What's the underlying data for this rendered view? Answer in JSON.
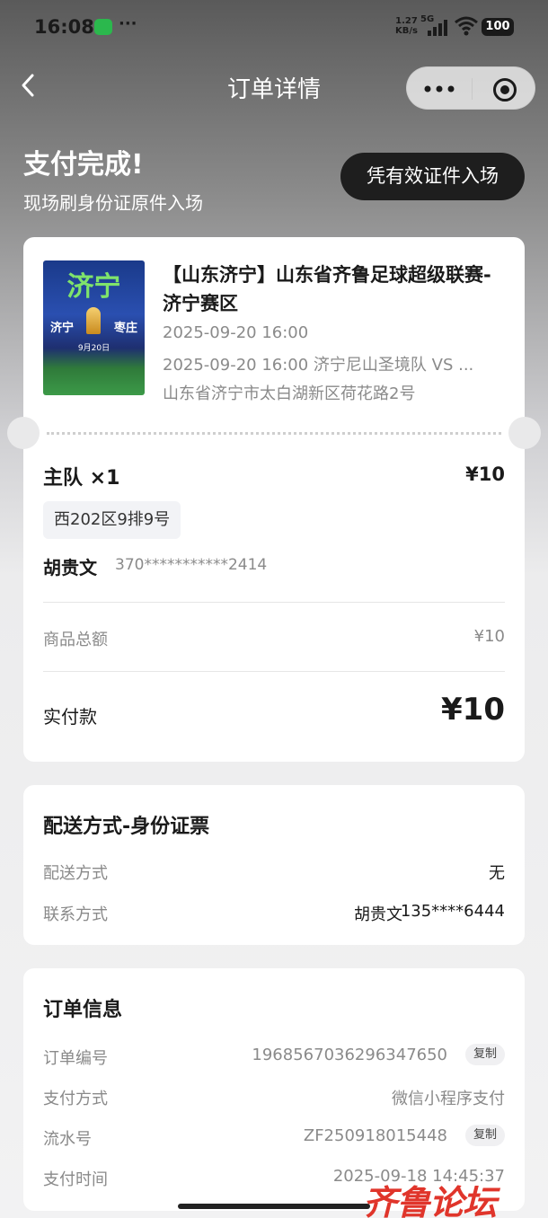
{
  "status_bar": {
    "time": "16:08",
    "speed": "1.27",
    "speed_unit": "KB/s",
    "network": "5G",
    "battery": "100"
  },
  "nav": {
    "title": "订单详情"
  },
  "hero": {
    "title": "支付完成!",
    "subtitle": "现场刷身份证原件入场",
    "button": "凭有效证件入场"
  },
  "event": {
    "poster_title": "济宁",
    "poster_home": "济宁",
    "poster_away": "枣庄",
    "poster_date": "9月20日",
    "title": "【山东济宁】山东省齐鲁足球超级联赛-济宁赛区",
    "datetime": "2025-09-20 16:00",
    "session": "2025-09-20 16:00 济宁尼山圣境队 VS ...",
    "venue": "山东省济宁市太白湖新区荷花路2号"
  },
  "ticket": {
    "label": "主队 ×1",
    "price": "¥10",
    "seat": "西202区9排9号",
    "holder_name": "胡贵文",
    "holder_id": "370***********2414"
  },
  "summary": {
    "goods_total_label": "商品总额",
    "goods_total": "¥10",
    "paid_label": "实付款",
    "paid": "¥10"
  },
  "delivery": {
    "title": "配送方式-身份证票",
    "method_label": "配送方式",
    "method": "无",
    "contact_label": "联系方式",
    "contact_name": "胡贵文",
    "contact_phone": "135****6444"
  },
  "order": {
    "title": "订单信息",
    "number_label": "订单编号",
    "number": "1968567036296347650",
    "pay_method_label": "支付方式",
    "pay_method": "微信小程序支付",
    "serial_label": "流水号",
    "serial": "ZF250918015448",
    "pay_time_label": "支付时间",
    "pay_time": "2025-09-18 14:45:37",
    "copy_label": "复制"
  },
  "watermark": "齐鲁论坛"
}
